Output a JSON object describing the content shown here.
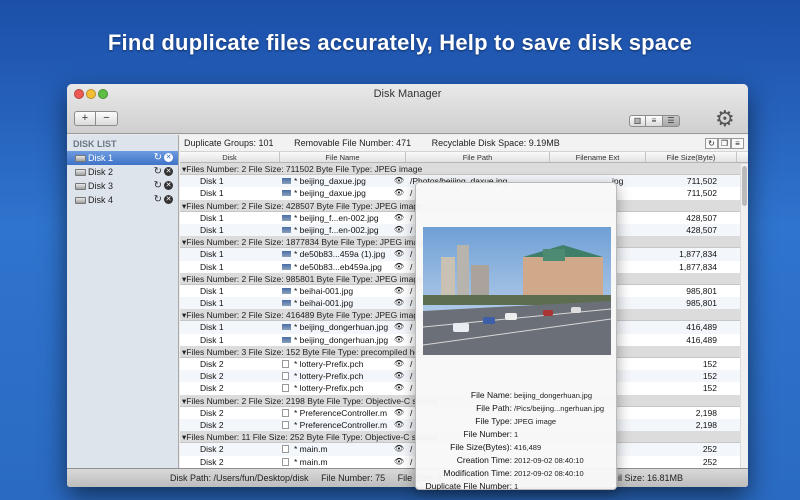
{
  "headline": "Find duplicate files accurately, Help to save disk space",
  "window": {
    "title": "Disk Manager",
    "add_label": "+",
    "remove_label": "−"
  },
  "sidebar": {
    "header": "DISK LIST",
    "items": [
      {
        "label": "Disk 1",
        "selected": true
      },
      {
        "label": "Disk 2",
        "selected": false
      },
      {
        "label": "Disk 3",
        "selected": false
      },
      {
        "label": "Disk 4",
        "selected": false
      }
    ]
  },
  "summary": {
    "groups": "Duplicate Groups: 101",
    "removable": "Removable File Number: 471",
    "recyclable": "Recyclable Disk Space: 9.19MB"
  },
  "columns": [
    "Disk",
    "File Name",
    "File Path",
    "Filename Ext",
    "File Size(Byte)"
  ],
  "rows": [
    {
      "type": "group",
      "text": "▾Files Number: 2    File Size: 711502 Byte    File Type: JPEG image"
    },
    {
      "type": "file",
      "disk": "Disk 1",
      "name": "* beijing_daxue.jpg",
      "path": "/Photos/beijing_daxue.jpg",
      "ext": "jpg",
      "size": "711,502",
      "icon": "photo"
    },
    {
      "type": "file",
      "disk": "Disk 1",
      "name": "* beijing_daxue.jpg",
      "path": "/",
      "ext": "",
      "size": "711,502",
      "icon": "photo"
    },
    {
      "type": "group",
      "text": "▾Files Number: 2    File Size: 428507 Byte    File Type: JPEG image"
    },
    {
      "type": "file",
      "disk": "Disk 1",
      "name": "* beijing_f...en-002.jpg",
      "path": "/",
      "ext": "",
      "size": "428,507",
      "icon": "photo"
    },
    {
      "type": "file",
      "disk": "Disk 1",
      "name": "* beijing_f...en-002.jpg",
      "path": "/",
      "ext": "",
      "size": "428,507",
      "icon": "photo"
    },
    {
      "type": "group",
      "text": "▾Files Number: 2    File Size: 1877834 Byte    File Type: JPEG image"
    },
    {
      "type": "file",
      "disk": "Disk 1",
      "name": "* de50b83...459a (1).jpg",
      "path": "/",
      "ext": "",
      "size": "1,877,834",
      "icon": "photo"
    },
    {
      "type": "file",
      "disk": "Disk 1",
      "name": "* de50b83...eb459a.jpg",
      "path": "/",
      "ext": "",
      "size": "1,877,834",
      "icon": "photo"
    },
    {
      "type": "group",
      "text": "▾Files Number: 2    File Size: 985801 Byte    File Type: JPEG image"
    },
    {
      "type": "file",
      "disk": "Disk 1",
      "name": "* beihai-001.jpg",
      "path": "/",
      "ext": "",
      "size": "985,801",
      "icon": "photo"
    },
    {
      "type": "file",
      "disk": "Disk 1",
      "name": "* beihai-001.jpg",
      "path": "/",
      "ext": "",
      "size": "985,801",
      "icon": "photo"
    },
    {
      "type": "group",
      "text": "▾Files Number: 2    File Size: 416489 Byte    File Type: JPEG image"
    },
    {
      "type": "file",
      "disk": "Disk 1",
      "name": "* beijing_dongerhuan.jpg",
      "path": "/",
      "ext": "",
      "size": "416,489",
      "icon": "photo"
    },
    {
      "type": "file",
      "disk": "Disk 1",
      "name": "* beijing_dongerhuan.jpg",
      "path": "/",
      "ext": "",
      "size": "416,489",
      "icon": "photo"
    },
    {
      "type": "group",
      "text": "▾Files Number: 3    File Size: 152 Byte    File Type: precompiled header"
    },
    {
      "type": "file",
      "disk": "Disk 2",
      "name": "* lottery-Prefix.pch",
      "path": "/",
      "ext": "",
      "size": "152",
      "icon": "file"
    },
    {
      "type": "file",
      "disk": "Disk 2",
      "name": "* lottery-Prefix.pch",
      "path": "/",
      "ext": "",
      "size": "152",
      "icon": "file"
    },
    {
      "type": "file",
      "disk": "Disk 2",
      "name": "* lottery-Prefix.pch",
      "path": "/",
      "ext": "",
      "size": "152",
      "icon": "file"
    },
    {
      "type": "group",
      "text": "▾Files Number: 2    File Size: 2198 Byte    File Type: Objective-C source"
    },
    {
      "type": "file",
      "disk": "Disk 2",
      "name": "* PreferenceController.m",
      "path": "/",
      "ext": "",
      "size": "2,198",
      "icon": "file"
    },
    {
      "type": "file",
      "disk": "Disk 2",
      "name": "* PreferenceController.m",
      "path": "/",
      "ext": "",
      "size": "2,198",
      "icon": "file"
    },
    {
      "type": "group",
      "text": "▾Files Number: 11    File Size: 252 Byte    File Type: Objective-C source"
    },
    {
      "type": "file",
      "disk": "Disk 2",
      "name": "* main.m",
      "path": "/",
      "ext": "",
      "size": "252",
      "icon": "file"
    },
    {
      "type": "file",
      "disk": "Disk 2",
      "name": "* main.m",
      "path": "/",
      "ext": "",
      "size": "252",
      "icon": "file"
    }
  ],
  "popover": {
    "fields": [
      {
        "key": "File Name:",
        "value": "beijing_dongerhuan.jpg"
      },
      {
        "key": "File Path:",
        "value": "/Pics/beijing...ngerhuan.jpg"
      },
      {
        "key": "File Type:",
        "value": "JPEG image"
      },
      {
        "key": "File Number:",
        "value": "1"
      },
      {
        "key": "File Size(Bytes):",
        "value": "416,489"
      },
      {
        "key": "Creation Time:",
        "value": "2012-09-02  08:40:10"
      },
      {
        "key": "Modification Time:",
        "value": "2012-09-02  08:40:10"
      },
      {
        "key": "Duplicate File Number:",
        "value": "1"
      }
    ]
  },
  "status": {
    "path": "Disk Path:  /Users/fun/Desktop/disk",
    "number": "File Number: 75",
    "file_size_prefix": "File Size: 2",
    "total_size": "il Size: 16.81MB"
  },
  "colors": {
    "background": "#2a6ac2",
    "selection": "#3f73c8"
  }
}
